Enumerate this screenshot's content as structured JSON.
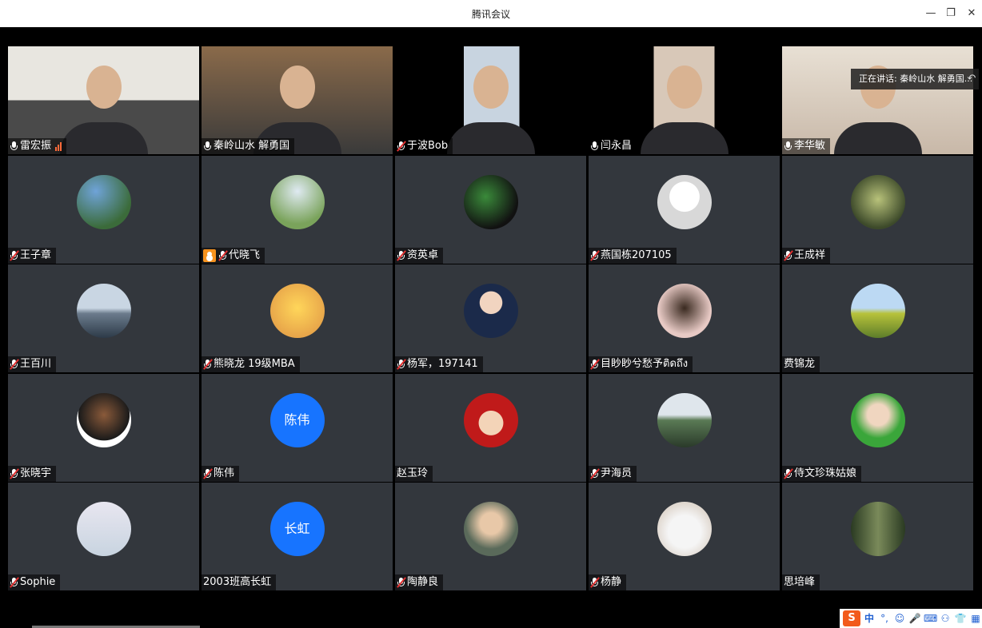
{
  "window": {
    "title": "腾讯会议",
    "minimize_icon": "—",
    "maximize_icon": "❐",
    "close_icon": "✕"
  },
  "speaking_banner": {
    "text": "正在讲话: 秦岭山水 解勇国...",
    "back_icon": "↶"
  },
  "participants": [
    {
      "name": "雷宏振",
      "mic": "on",
      "video": true
    },
    {
      "name": "秦岭山水 解勇国",
      "mic": "on",
      "video": true,
      "active": true
    },
    {
      "name": "于波Bob",
      "mic": "off",
      "video": true
    },
    {
      "name": "闫永昌",
      "mic": "on",
      "video": true
    },
    {
      "name": "李华敏",
      "mic": "on",
      "video": true
    },
    {
      "name": "王子章",
      "mic": "off"
    },
    {
      "name": "代晓飞",
      "mic": "off",
      "hand": true
    },
    {
      "name": "资英卓",
      "mic": "off"
    },
    {
      "name": "燕国栋207105",
      "mic": "off"
    },
    {
      "name": "王成祥",
      "mic": "off"
    },
    {
      "name": "王百川",
      "mic": "off"
    },
    {
      "name": "熊晓龙  19级MBA",
      "mic": "off"
    },
    {
      "name": "杨军，197141",
      "mic": "off"
    },
    {
      "name": "目眇眇兮愁予ติดถึง",
      "mic": "off"
    },
    {
      "name": "费锦龙",
      "mic": "none"
    },
    {
      "name": "张晓宇",
      "mic": "off"
    },
    {
      "name": "陈伟",
      "mic": "off",
      "avatar_text": "陈伟"
    },
    {
      "name": "赵玉玲",
      "mic": "none"
    },
    {
      "name": "尹海员",
      "mic": "off"
    },
    {
      "name": "侍文珍珠姑娘",
      "mic": "off"
    },
    {
      "name": "Sophie",
      "mic": "off"
    },
    {
      "name": "2003班高长虹",
      "mic": "none",
      "avatar_text": "长虹"
    },
    {
      "name": "陶静良",
      "mic": "off"
    },
    {
      "name": "杨静",
      "mic": "off"
    },
    {
      "name": "思培峰",
      "mic": "none"
    }
  ],
  "ime": {
    "logo": "S",
    "lang": "中",
    "items": [
      "°,",
      "☺",
      "🎤",
      "⌨",
      "⚇",
      "👕",
      "▦"
    ]
  },
  "colors": {
    "tile_bg": "#33373d",
    "active_border": "#1bb06a",
    "text_avatar_bg": "#1774ff",
    "mute_red": "#e03030"
  }
}
